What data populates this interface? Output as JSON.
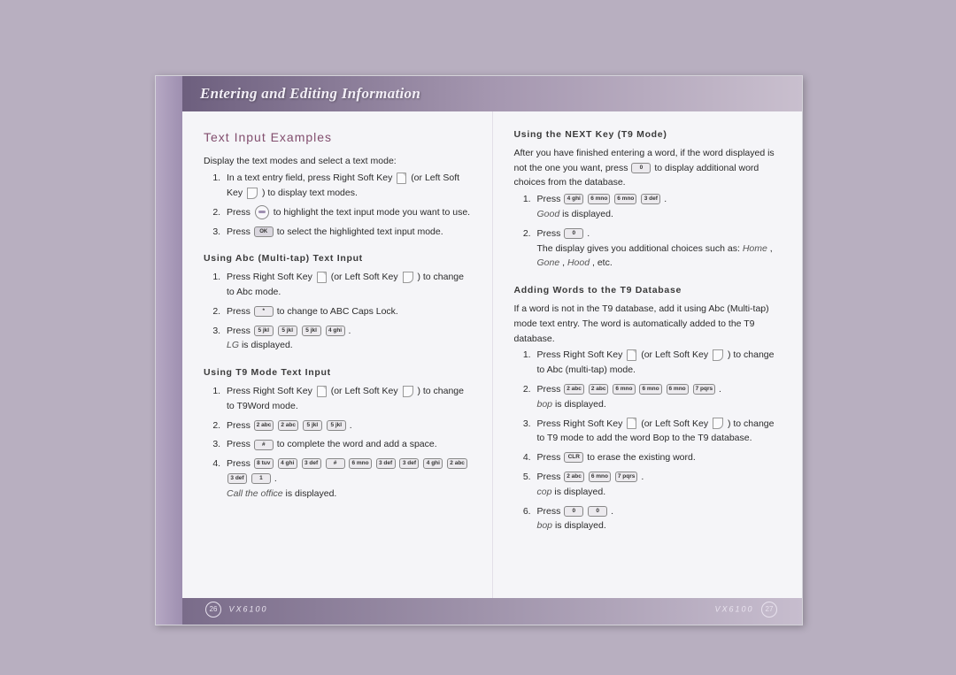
{
  "header": {
    "title": "Entering and Editing Information"
  },
  "left": {
    "sectionTitle": "Text Input Examples",
    "intro": "Display the text modes and select a text mode:",
    "list1": {
      "i1a": "In a text entry field, press Right Soft Key ",
      "i1b": " (or Left Soft Key ",
      "i1c": " ) to display text modes.",
      "i2a": "Press ",
      "i2b": " to highlight the text input mode you want to use.",
      "i3a": "Press ",
      "i3b": " to select the highlighted text input mode."
    },
    "sub1": "Using Abc (Multi-tap) Text Input",
    "abc": {
      "i1a": "Press Right Soft Key ",
      "i1b": " (or Left Soft Key ",
      "i1c": " ) to change to Abc mode.",
      "i2a": "Press ",
      "i2b": " to change to ABC Caps Lock.",
      "i3a": "Press ",
      "i3tail": " .",
      "i3res_i": "LG",
      "i3res_t": " is displayed."
    },
    "sub2": "Using T9 Mode Text Input",
    "t9": {
      "i1a": "Press Right Soft Key ",
      "i1b": " (or Left Soft Key ",
      "i1c": " ) to change to T9Word mode.",
      "i2a": "Press ",
      "i2tail": " .",
      "i3a": "Press ",
      "i3b": " to complete the word and add a space.",
      "i4a": "Press ",
      "i4tail": " .",
      "i4res_i": "Call the office",
      "i4res_t": " is displayed."
    }
  },
  "right": {
    "sub1": "Using the NEXT Key (T9 Mode)",
    "next": {
      "p1a": "After you have finished entering a word, if the word displayed is not the one you want, press ",
      "p1b": " to display additional word choices from the database.",
      "i1a": "Press ",
      "i1tail": " .",
      "i1res_i": "Good",
      "i1res_t": " is displayed.",
      "i2a": "Press ",
      "i2tail": " .",
      "i2b": "The display gives you additional choices such as: ",
      "i2c": "Home",
      "i2d": ", ",
      "i2e": "Gone",
      "i2f": ", ",
      "i2g": "Hood",
      "i2h": ", etc."
    },
    "sub2": "Adding Words to the T9 Database",
    "add": {
      "p1": "If a word is not in the T9 database, add it using Abc (Multi-tap) mode text entry. The word is automatically added to the T9 database.",
      "i1a": "Press Right Soft Key ",
      "i1b": " (or Left Soft Key ",
      "i1c": " ) to change to Abc (multi-tap) mode.",
      "i2a": "Press ",
      "i2tail": " .",
      "i2res_i": "bop",
      "i2res_t": " is displayed.",
      "i3a": "Press Right Soft Key ",
      "i3b": " (or Left Soft Key ",
      "i3c": " ) to change to T9 mode to add the word Bop to the T9 database.",
      "i4a": "Press ",
      "i4b": " to erase the existing word.",
      "i5a": "Press ",
      "i5tail": " .",
      "i5res_i": "cop",
      "i5res_t": " is displayed.",
      "i6a": "Press ",
      "i6tail": " .",
      "i6res_i": "bop",
      "i6res_t": " is displayed."
    }
  },
  "keys": {
    "ok": "OK",
    "star": "*",
    "hash": "# ",
    "zero": "0 ",
    "one": "1 ",
    "two": "2 abc",
    "three": "3 def",
    "four": "4 ghi",
    "five": "5 jkl",
    "six": "6 mno",
    "seven": "7 pqrs",
    "eight": "8 tuv",
    "clr": "CLR"
  },
  "footer": {
    "model": "VX6100",
    "pLeft": "26",
    "pRight": "27"
  }
}
